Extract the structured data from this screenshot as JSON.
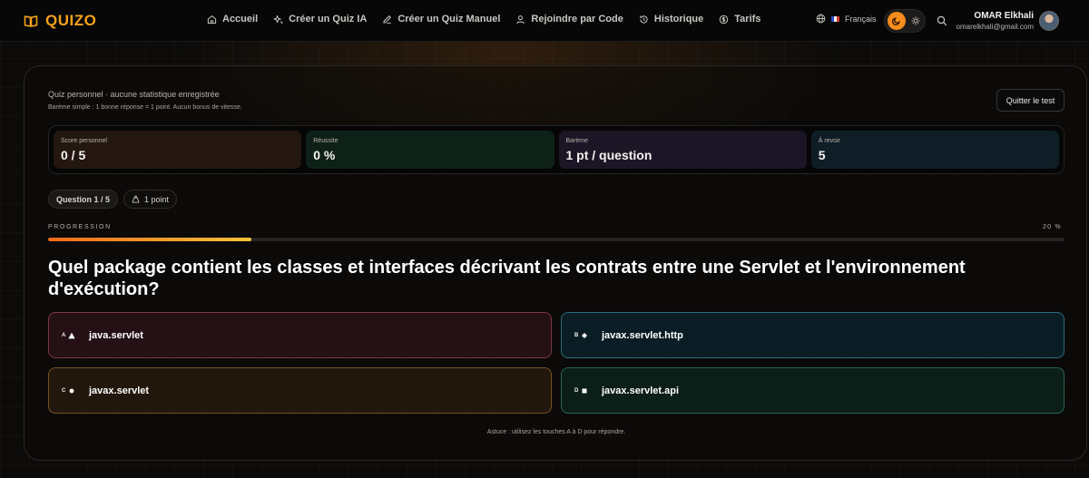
{
  "nav": {
    "brand": "QUIZO",
    "links": [
      {
        "label": "Accueil",
        "icon": "home-icon"
      },
      {
        "label": "Créer un Quiz IA",
        "icon": "sparkles-icon"
      },
      {
        "label": "Créer un Quiz Manuel",
        "icon": "pencil-icon"
      },
      {
        "label": "Rejoindre par Code",
        "icon": "users-icon"
      },
      {
        "label": "Historique",
        "icon": "history-icon"
      },
      {
        "label": "Tarifs",
        "icon": "dollar-icon"
      }
    ],
    "language": "Français",
    "user_name": "OMAR Elkhali",
    "user_email": "omarelkhali@gmail.com"
  },
  "quiz": {
    "subtitle": "Quiz personnel · aucune statistique enregistrée",
    "bareme_note": "Barème simple : 1 bonne réponse = 1 point. Aucun bonus de vitesse.",
    "quit_label": "Quitter le test",
    "stats": [
      {
        "label": "Score personnel",
        "value": "0 / 5"
      },
      {
        "label": "Réussite",
        "value": "0 %"
      },
      {
        "label": "Barème",
        "value": "1 pt / question"
      },
      {
        "label": "À revoir",
        "value": "5"
      }
    ],
    "question_pill": "Question 1 / 5",
    "points_pill": "1 point",
    "progress_label": "PROGRESSION",
    "progress_text": "20 %",
    "progress_fraction": 0.2,
    "question": "Quel package contient les classes et interfaces décrivant les contrats entre une Servlet et l'environnement d'exécution?",
    "answers": [
      {
        "key": "A",
        "shape": "triangle-icon",
        "text": "java.servlet"
      },
      {
        "key": "B",
        "shape": "diamond-icon",
        "text": "javax.servlet.http"
      },
      {
        "key": "C",
        "shape": "circle-icon",
        "text": "javax.servlet"
      },
      {
        "key": "D",
        "shape": "square-icon",
        "text": "javax.servlet.api"
      }
    ],
    "tip": "Astuce : utilisez les touches A à D pour répondre."
  },
  "colors": {
    "accent": "#f6a21a",
    "progress_start": "#f06a1c",
    "progress_end": "#f8c23a"
  }
}
